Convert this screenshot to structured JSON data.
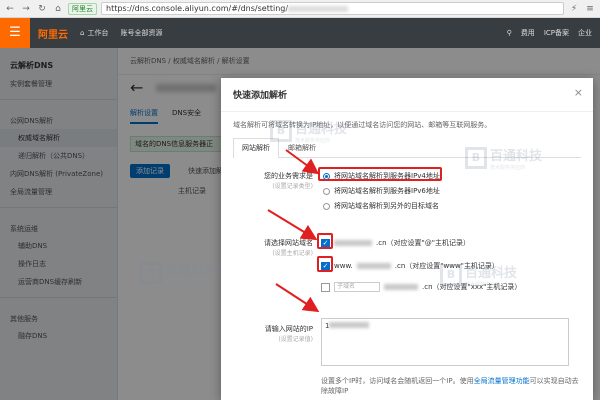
{
  "browser": {
    "site_badge": "阿里云",
    "url_prefix": "https://dns.console.aliyun.com/#/dns/setting/"
  },
  "topbar": {
    "logo": "阿里云",
    "workbench": "工作台",
    "account": "账号全部资源",
    "right_items": [
      "费用",
      "ICP备案",
      "企业"
    ]
  },
  "sidebar": {
    "title": "云解析DNS",
    "overview": "实例套餐管理",
    "group_public": "公网DNS解析",
    "public_items": [
      "权威域名解析",
      "递归解析（公共DNS）"
    ],
    "private": "内网DNS解析 (PrivateZone)",
    "gtm": "全局流量管理",
    "group_system": "系统运维",
    "system_items": [
      "辅助DNS",
      "操作日志",
      "运营商DNS缓存刷新"
    ],
    "group_other": "其他服务",
    "other_items": [
      "融存DNS"
    ]
  },
  "main": {
    "breadcrumb": "云解析DNS  /  权威域名解析  /  解析设置",
    "tabs": [
      "解析设置",
      "DNS安全"
    ],
    "notice": "域名的DNS信息服务器正",
    "add_button": "添加记录",
    "quick_button": "快速添加解析",
    "host_label": "主机记录"
  },
  "modal": {
    "title": "快速添加解析",
    "close": "×",
    "desc": "域名解析可将域名转换为IP地址，以便通过域名访问您的网站、邮箱等互联网服务。",
    "tabs": [
      "网站解析",
      "邮箱解析"
    ],
    "business_label": "您的业务需求是",
    "business_sub": "(设置记录类型)",
    "options": [
      "将网站域名解析到服务器IPv4地址",
      "将网站域名解析到服务器IPv6地址",
      "将网站域名解析到另外的目标域名"
    ],
    "domain_label": "请选择网站域名",
    "domain_sub": "(设置主机记录)",
    "domain_rows": [
      ".cn（对应设置\"@\"主机记录）",
      "www.",
      ".cn（对应设置\"www\"主机记录）",
      "子域名",
      ".cn（对应设置\"xxx\"主机记录）"
    ],
    "ip_label": "请输入网站的IP",
    "ip_sub": "(设置记录值)",
    "ip_value": "1",
    "hint_a": "设置多个IP时，访问域名会随机返回一个IP。使用",
    "hint_link": "全局流量管理功能",
    "hint_b": "可以实现自动去除故障IP"
  },
  "watermark": {
    "logo": "B",
    "name": "百通科技",
    "sub": "技术服务供应商"
  },
  "colors": {
    "accent": "#0070cc",
    "brand": "#ff6a00",
    "highlight": "#e02020"
  }
}
